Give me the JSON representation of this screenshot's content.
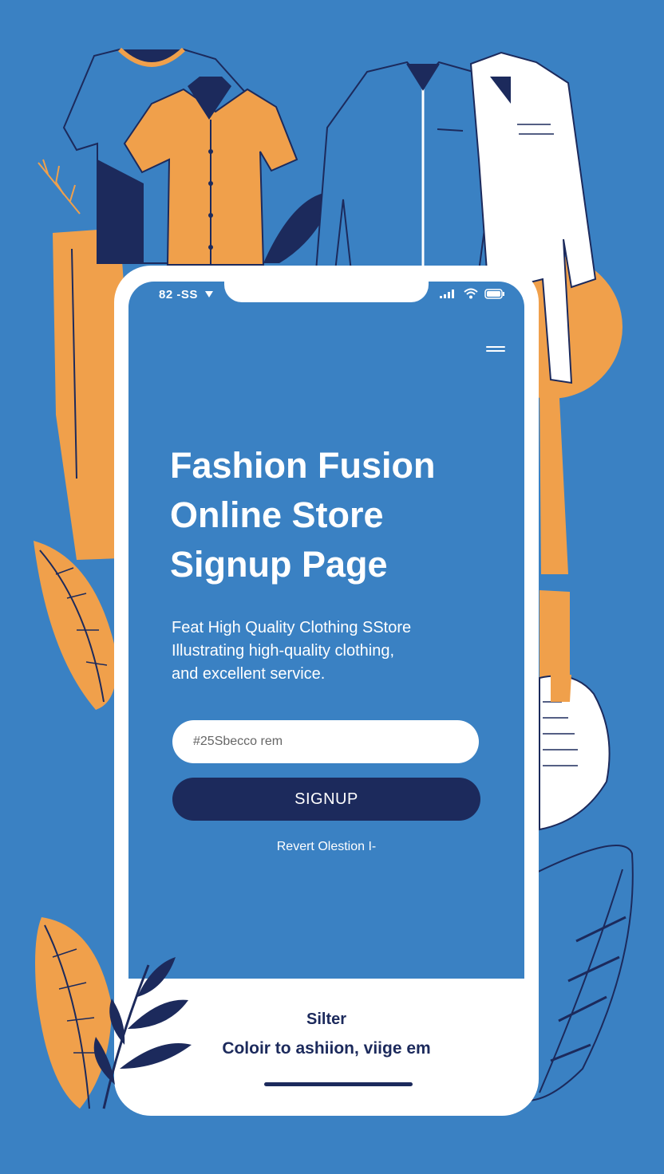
{
  "colors": {
    "background": "#3a81c3",
    "navy": "#1c2a5c",
    "orange": "#f0a04b",
    "white": "#ffffff"
  },
  "status_bar": {
    "time": "82 -SS",
    "icons": [
      "location-arrow-icon",
      "signal-icon",
      "wifi-icon",
      "battery-icon"
    ]
  },
  "menu": {
    "icon": "hamburger-menu-icon"
  },
  "hero": {
    "title_lines": [
      "Fashion Fusion",
      "Online Store",
      "Signup Page"
    ],
    "subtitle_lines": [
      "Feat High Quality Clothing SStore",
      "Illustrating high-quality clothing,",
      "and excellent service."
    ]
  },
  "form": {
    "input_placeholder": "#25Sbecco rem",
    "signup_label": "SIGNUP",
    "link_text": "Revert Olestion I-"
  },
  "footer": {
    "title": "Silter",
    "tagline": "Coloir to ashiion, viige em"
  },
  "illustrations": [
    "t-shirt",
    "orange-shirt",
    "pants",
    "jacket",
    "white-shirt",
    "sneaker",
    "leaves"
  ]
}
